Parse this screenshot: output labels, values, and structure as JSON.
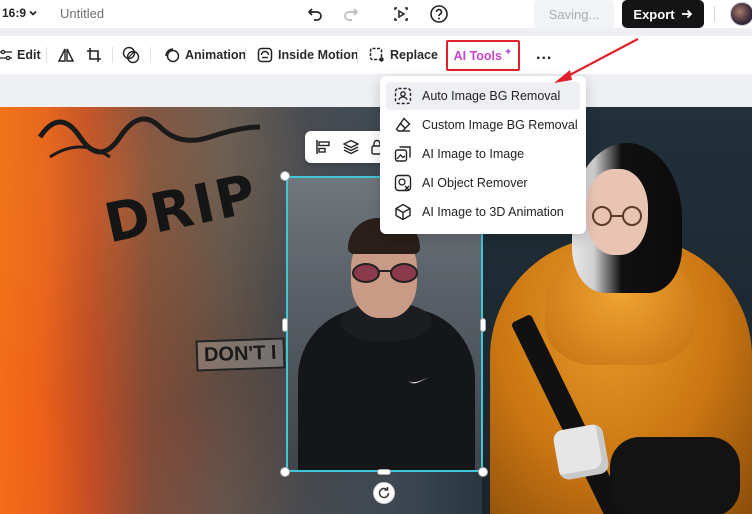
{
  "topbar": {
    "ratio": "16:9",
    "doc_title": "Untitled",
    "saving_label": "Saving...",
    "export_label": "Export"
  },
  "toolbar": {
    "edit": "Edit",
    "animation": "Animation",
    "inside_motion": "Inside Motion",
    "replace": "Replace",
    "ai_tools": "AI Tools",
    "more": "..."
  },
  "canvas": {
    "graffiti_main": "DRIP",
    "graffiti_sign": "DON'T I"
  },
  "menu": {
    "items": [
      {
        "label": "Auto Image BG Removal",
        "icon": "auto-bg-removal-icon"
      },
      {
        "label": "Custom Image BG Removal",
        "icon": "eraser-icon"
      },
      {
        "label": "AI Image to Image",
        "icon": "image-to-image-icon"
      },
      {
        "label": "AI Object Remover",
        "icon": "object-remover-icon"
      },
      {
        "label": "AI Image to 3D Animation",
        "icon": "cube-icon"
      }
    ]
  },
  "colors": {
    "accent_selection": "#3fc6d8",
    "highlight_box": "#e0202a",
    "ai_gradient": "#c743d0",
    "export_bg": "#141414"
  }
}
